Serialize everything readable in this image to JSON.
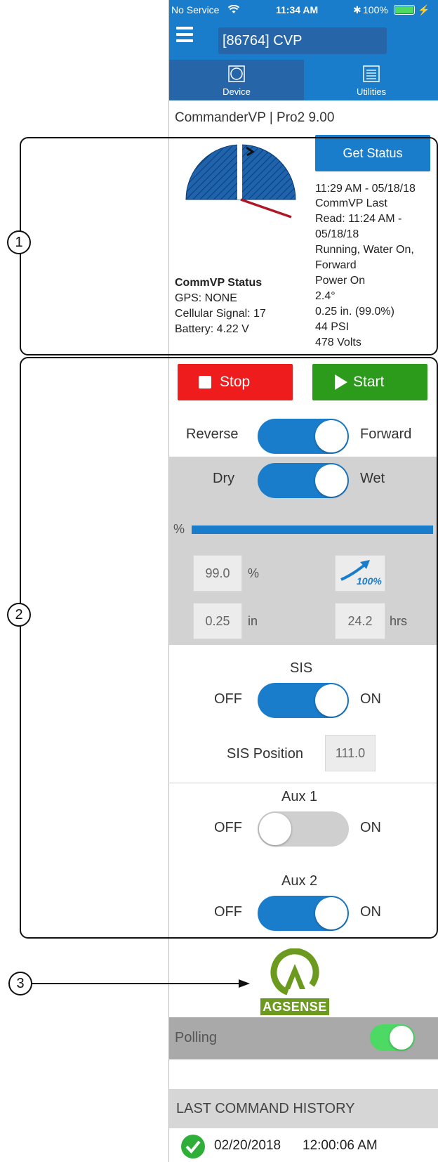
{
  "status_bar": {
    "carrier": "No Service",
    "time": "11:34 AM",
    "battery": "100%"
  },
  "header": {
    "title": "[86764] CVP"
  },
  "tabs": [
    {
      "label": "Device",
      "active": true
    },
    {
      "label": "Utilities",
      "active": false
    }
  ],
  "device": {
    "title": "CommanderVP | Pro2 9.00"
  },
  "status_panel": {
    "get_status_label": "Get Status",
    "info_lines": [
      "11:29 AM - 05/18/18",
      "CommVP Last",
      "Read: 11:24 AM -",
      "05/18/18",
      "Running, Water On,",
      "Forward",
      "Power On",
      "2.4°",
      "0.25 in. (99.0%)",
      "44  PSI",
      "478  Volts"
    ],
    "commvp_status_label": "CommVP Status",
    "gps": "GPS: NONE",
    "cellular": "Cellular Signal: 17",
    "battery": "Battery: 4.22 V"
  },
  "controls": {
    "stop_label": "Stop",
    "start_label": "Start",
    "direction": {
      "left": "Reverse",
      "right": "Forward",
      "on": true
    },
    "wetdry": {
      "left": "Dry",
      "right": "Wet",
      "on": true
    },
    "percent_label": "%",
    "percent_value": "99.0",
    "percent_unit": "%",
    "speed_badge": "100%",
    "depth_value": "0.25",
    "depth_unit": "in",
    "hours_value": "24.2",
    "hours_unit": "hrs",
    "sis": {
      "title": "SIS",
      "left": "OFF",
      "right": "ON",
      "on": true
    },
    "sis_position_label": "SIS Position",
    "sis_position_value": "111.0",
    "aux1": {
      "title": "Aux 1",
      "left": "OFF",
      "right": "ON",
      "on": false
    },
    "aux2": {
      "title": "Aux 2",
      "left": "OFF",
      "right": "ON",
      "on": true
    }
  },
  "logo_text": "AGSENSE",
  "polling": {
    "label": "Polling",
    "on": true
  },
  "history": {
    "title": "LAST COMMAND HISTORY",
    "entries": [
      {
        "date": "02/20/2018",
        "time": "12:00:06 AM"
      }
    ]
  },
  "annotations": [
    "1",
    "2",
    "3"
  ],
  "colors": {
    "brand_blue": "#1a7dcc",
    "dark_blue": "#2765a9",
    "stop_red": "#ee1c1c",
    "start_green": "#2c9b1c",
    "logo_green": "#6c9a1f",
    "polling_green": "#4cd964"
  }
}
